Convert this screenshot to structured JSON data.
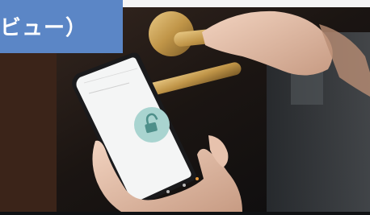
{
  "caption": {
    "text": "ビュー）"
  },
  "phone_app": {
    "title": "",
    "status": "",
    "lock_icon": "lock-icon",
    "nav_icons": [
      "home-icon",
      "key-icon",
      "history-icon",
      "settings-icon"
    ]
  },
  "colors": {
    "caption_band": "#5b86c6",
    "lock_circle": "#a9d4d0",
    "lock_glyph": "#4e8f8a",
    "background": "#101214"
  }
}
